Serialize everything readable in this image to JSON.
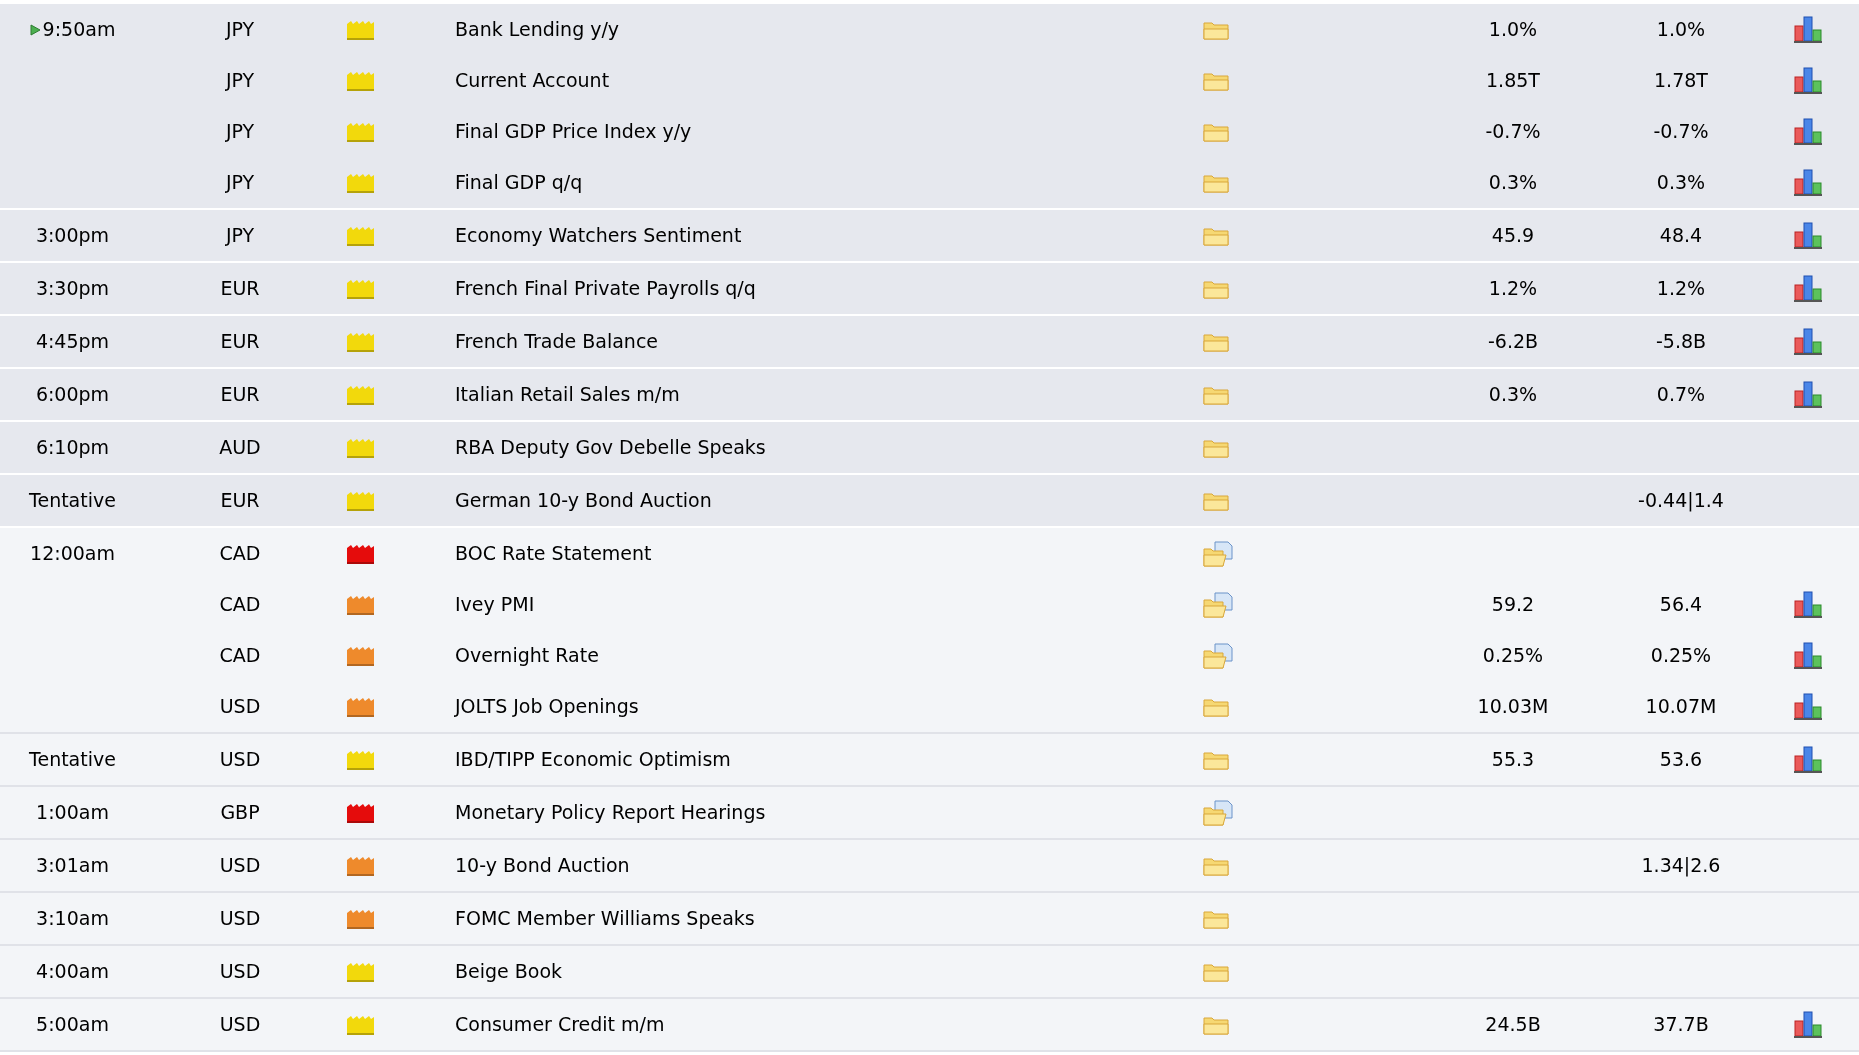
{
  "groups": [
    {
      "past": true,
      "current": true,
      "time": "9:50am",
      "rows": [
        {
          "currency": "JPY",
          "color": "#f2d90c",
          "event": "Bank Lending y/y",
          "with_document": false,
          "column_6": "1.0%",
          "column_7": "1.0%",
          "chart": true
        },
        {
          "currency": "JPY",
          "color": "#f2d90c",
          "event": "Current Account",
          "with_document": false,
          "column_6": "1.85T",
          "column_7": "1.78T",
          "chart": true
        },
        {
          "currency": "JPY",
          "color": "#f2d90c",
          "event": "Final GDP Price Index y/y",
          "with_document": false,
          "column_6": "-0.7%",
          "column_7": "-0.7%",
          "chart": true
        },
        {
          "currency": "JPY",
          "color": "#f2d90c",
          "event": "Final GDP q/q",
          "with_document": false,
          "column_6": "0.3%",
          "column_7": "0.3%",
          "chart": true
        }
      ]
    },
    {
      "past": true,
      "current": false,
      "time": "3:00pm",
      "rows": [
        {
          "currency": "JPY",
          "color": "#f2d90c",
          "event": "Economy Watchers Sentiment",
          "with_document": false,
          "column_6": "45.9",
          "column_7": "48.4",
          "chart": true
        }
      ]
    },
    {
      "past": true,
      "current": false,
      "time": "3:30pm",
      "rows": [
        {
          "currency": "EUR",
          "color": "#f2d90c",
          "event": "French Final Private Payrolls q/q",
          "with_document": false,
          "column_6": "1.2%",
          "column_7": "1.2%",
          "chart": true
        }
      ]
    },
    {
      "past": true,
      "current": false,
      "time": "4:45pm",
      "rows": [
        {
          "currency": "EUR",
          "color": "#f2d90c",
          "event": "French Trade Balance",
          "with_document": false,
          "column_6": "-6.2B",
          "column_7": "-5.8B",
          "chart": true
        }
      ]
    },
    {
      "past": true,
      "current": false,
      "time": "6:00pm",
      "rows": [
        {
          "currency": "EUR",
          "color": "#f2d90c",
          "event": "Italian Retail Sales m/m",
          "with_document": false,
          "column_6": "0.3%",
          "column_7": "0.7%",
          "chart": true
        }
      ]
    },
    {
      "past": true,
      "current": false,
      "time": "6:10pm",
      "rows": [
        {
          "currency": "AUD",
          "color": "#f2d90c",
          "event": "RBA Deputy Gov Debelle Speaks",
          "with_document": false,
          "chart": false
        }
      ]
    },
    {
      "past": true,
      "current": false,
      "time": "Tentative",
      "rows": [
        {
          "currency": "EUR",
          "color": "#f2d90c",
          "event": "German 10-y Bond Auction",
          "with_document": false,
          "column_7": "-0.44|1.4",
          "chart": false
        }
      ]
    },
    {
      "past": false,
      "current": false,
      "time": "12:00am",
      "rows": [
        {
          "currency": "CAD",
          "color": "#e50c0c",
          "event": "BOC Rate Statement",
          "with_document": true,
          "chart": false
        },
        {
          "currency": "CAD",
          "color": "#ee8a2c",
          "event": "Ivey PMI",
          "with_document": true,
          "column_6": "59.2",
          "column_7": "56.4",
          "chart": true
        },
        {
          "currency": "CAD",
          "color": "#ee8a2c",
          "event": "Overnight Rate",
          "with_document": true,
          "column_6": "0.25%",
          "column_7": "0.25%",
          "chart": true
        },
        {
          "currency": "USD",
          "color": "#ee8a2c",
          "event": "JOLTS Job Openings",
          "with_document": false,
          "column_6": "10.03M",
          "column_7": "10.07M",
          "chart": true
        }
      ]
    },
    {
      "past": false,
      "current": false,
      "time": "Tentative",
      "rows": [
        {
          "currency": "USD",
          "color": "#f2d90c",
          "event": "IBD/TIPP Economic Optimism",
          "with_document": false,
          "column_6": "55.3",
          "column_7": "53.6",
          "chart": true
        }
      ]
    },
    {
      "past": false,
      "current": false,
      "time": "1:00am",
      "rows": [
        {
          "currency": "GBP",
          "color": "#e50c0c",
          "event": "Monetary Policy Report Hearings",
          "with_document": true,
          "chart": false
        }
      ]
    },
    {
      "past": false,
      "current": false,
      "time": "3:01am",
      "rows": [
        {
          "currency": "USD",
          "color": "#ee8a2c",
          "event": "10-y Bond Auction",
          "with_document": false,
          "column_7": "1.34|2.6",
          "chart": false
        }
      ]
    },
    {
      "past": false,
      "current": false,
      "time": "3:10am",
      "rows": [
        {
          "currency": "USD",
          "color": "#ee8a2c",
          "event": "FOMC Member Williams Speaks",
          "with_document": false,
          "chart": false
        }
      ]
    },
    {
      "past": false,
      "current": false,
      "time": "4:00am",
      "rows": [
        {
          "currency": "USD",
          "color": "#f2d90c",
          "event": "Beige Book",
          "with_document": false,
          "chart": false
        }
      ]
    },
    {
      "past": false,
      "current": false,
      "time": "5:00am",
      "rows": [
        {
          "currency": "USD",
          "color": "#f2d90c",
          "event": "Consumer Credit m/m",
          "with_document": false,
          "column_6": "24.5B",
          "column_7": "37.7B",
          "chart": true
        }
      ]
    }
  ]
}
